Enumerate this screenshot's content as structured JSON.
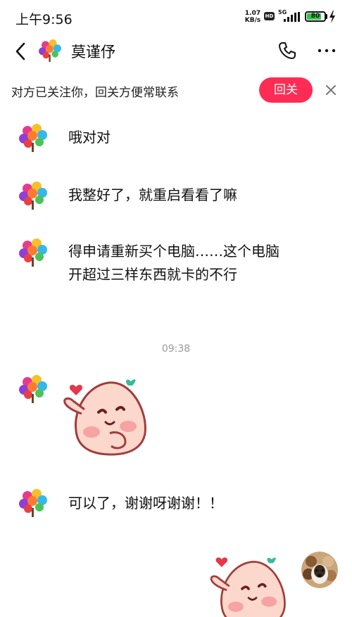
{
  "status_bar": {
    "time": "上午9:56",
    "net_speed_value": "1.07",
    "net_speed_unit": "KB/s",
    "hd_badge": "HD",
    "network": "5G",
    "battery": "80"
  },
  "header": {
    "contact_name": "莫谨伃",
    "icons": [
      "back-icon",
      "phone-icon",
      "more-icon"
    ]
  },
  "follow_banner": {
    "text": "对方已关注你，回关方便常联系",
    "button_label": "回关"
  },
  "messages": [
    {
      "sender": "contact",
      "type": "text",
      "text": "哦对对"
    },
    {
      "sender": "contact",
      "type": "text",
      "text": "我整好了，就重启看看了嘛"
    },
    {
      "sender": "contact",
      "type": "text",
      "text": "得申请重新买个电脑……这个电脑开超过三样东西就卡的不行"
    },
    {
      "type": "timestamp",
      "text": "09:38"
    },
    {
      "sender": "contact",
      "type": "sticker",
      "sticker": "peach-blush-sticker"
    },
    {
      "sender": "contact",
      "type": "text",
      "text": "可以了，谢谢呀谢谢！！"
    },
    {
      "sender": "me",
      "type": "sticker",
      "sticker": "peach-blush-sticker"
    }
  ],
  "colors": {
    "accent": "#fe2c55",
    "timestamp": "#9a9a9a",
    "battery_green": "#33c24a"
  }
}
